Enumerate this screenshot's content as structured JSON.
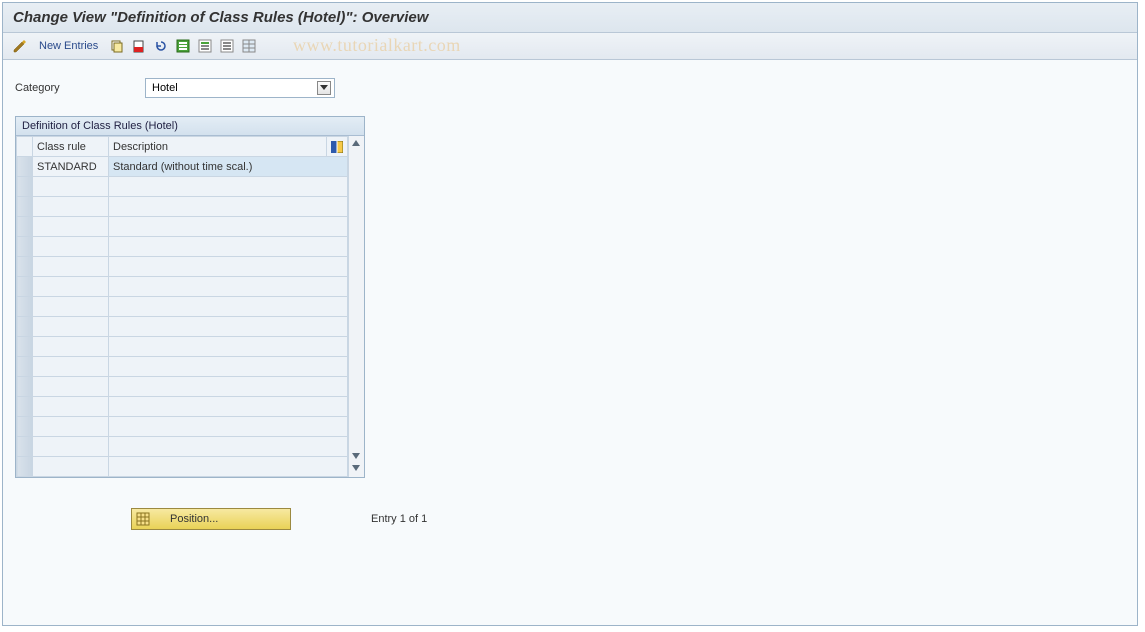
{
  "title": "Change View \"Definition of Class Rules (Hotel)\": Overview",
  "toolbar": {
    "new_entries_label": "New Entries",
    "icons": [
      "display-change-icon",
      "copy-icon",
      "delete-icon",
      "undo-icon",
      "select-all-icon",
      "select-block-icon",
      "deselect-icon",
      "table-settings-icon"
    ]
  },
  "watermark": "www.tutorialkart.com",
  "category": {
    "label": "Category",
    "value": "Hotel"
  },
  "panel": {
    "title": "Definition of Class Rules (Hotel)",
    "columns": {
      "class_rule": "Class rule",
      "description": "Description"
    },
    "rows": [
      {
        "class_rule": "STANDARD",
        "description": "Standard (without time scal.)"
      }
    ],
    "empty_row_count": 15
  },
  "footer": {
    "position_button": "Position...",
    "entry_text": "Entry 1 of 1"
  }
}
